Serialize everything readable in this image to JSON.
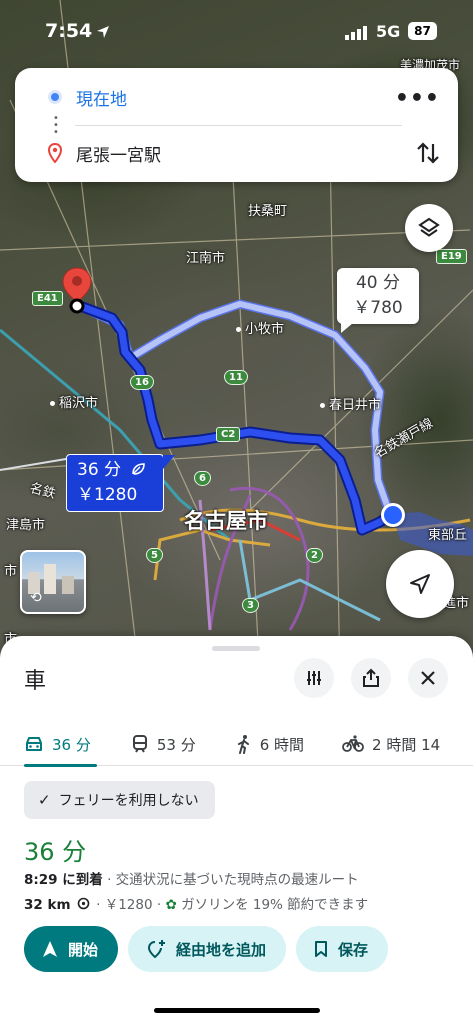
{
  "status_bar": {
    "time": "7:54",
    "network": "5G",
    "battery": "87"
  },
  "search": {
    "origin": "現在地",
    "destination": "尾張一宮駅"
  },
  "map": {
    "places": {
      "fuso": "扶桑町",
      "konan": "江南市",
      "komaki": "小牧市",
      "kasugai": "春日井市",
      "inazawa": "稲沢市",
      "nagoya": "名古屋市",
      "meitetsu_seto": "名鉄瀬戸線",
      "meitetsu": "名鉄",
      "tsushima": "津島市",
      "higashibu": "東部丘",
      "mino": "美濃加茂市",
      "edge1": "市",
      "edge2": "市",
      "edge3": "進市"
    },
    "shields": {
      "e41": "E41",
      "e19": "E19",
      "r16": "16",
      "r11": "11",
      "c2": "C2",
      "r6": "6",
      "r5": "5",
      "r2": "2",
      "r3": "3"
    },
    "alt_route": {
      "time": "40 分",
      "fare": "￥780"
    },
    "main_route": {
      "time": "36 分",
      "fare": "￥1280"
    }
  },
  "sheet": {
    "title": "車",
    "tabs": [
      {
        "label": "36 分",
        "icon": "car-icon"
      },
      {
        "label": "53 分",
        "icon": "train-icon"
      },
      {
        "label": "6 時間",
        "icon": "walk-icon"
      },
      {
        "label": "2 時間 14",
        "icon": "bike-icon"
      }
    ],
    "chip": "フェリーを利用しない",
    "duration": "36 分",
    "arrival_time": "8:29 に到着",
    "arrival_note": "· 交通状況に基づいた現時点の最速ルート",
    "distance": "32 km",
    "toll": "· ￥1280 ·",
    "fuel": "ガソリンを 19% 節約できます",
    "buttons": {
      "start": "開始",
      "add_stop": "経由地を追加",
      "save": "保存"
    }
  },
  "colors": {
    "route_main": "#1a3fd9",
    "route_alt": "#a9b8f5",
    "accent": "#00797f",
    "duration": "#188038"
  }
}
